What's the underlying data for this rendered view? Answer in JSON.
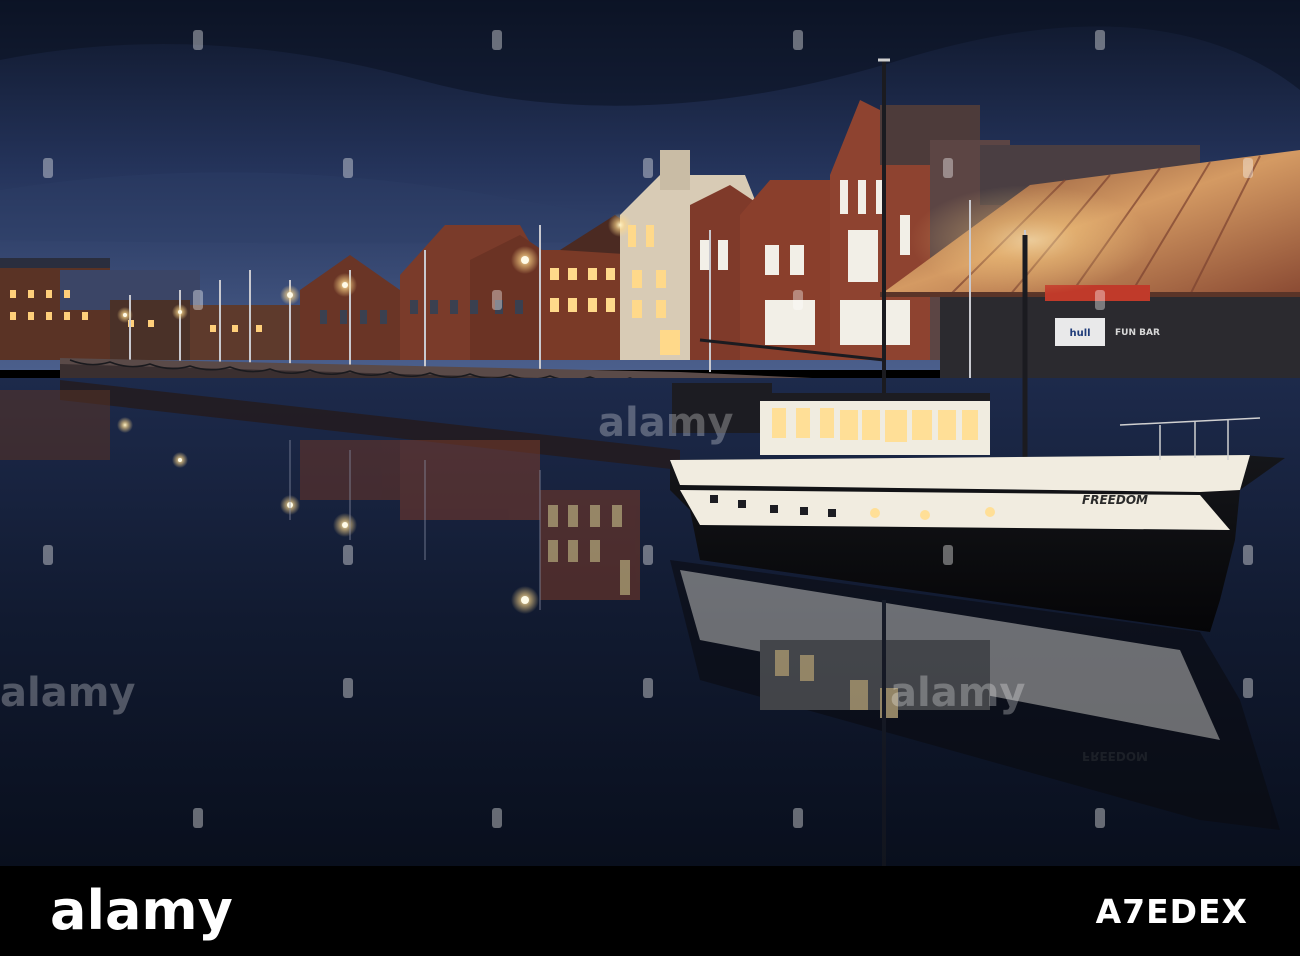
{
  "photo": {
    "subject": "Boat moored in a marina at dusk with illuminated waterfront buildings",
    "boat_name": "FREEDOM",
    "signage": {
      "sign_hull": "hull",
      "sign_bar": "FUN BAR"
    },
    "watermark": "alamy"
  },
  "footer": {
    "brand": "alamy",
    "image_id": "A7EDEX"
  },
  "colors": {
    "sky_top": "#141d33",
    "sky_bottom": "#3b4f7a",
    "water": "#0e1526",
    "brick": "#7a3b2a",
    "roof_copper": "#b0704a",
    "lamp_glow": "#ffd98a"
  }
}
